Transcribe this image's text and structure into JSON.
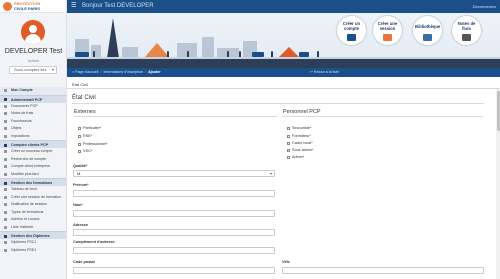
{
  "brand": {
    "line1": "PROTECTION",
    "line2": "CIVILE PARIS"
  },
  "profile": {
    "name": "DEVELOPER Test",
    "role": "Admin",
    "select_value": "Sous comptes liés"
  },
  "topbar": {
    "welcome": "Bonjour Test DEVELOPER",
    "logout": "Déconnexion"
  },
  "nav": {
    "mon_compte": "Mon Compte",
    "sections": [
      {
        "label": "Administratif PCP",
        "items": [
          "Documents PCP",
          "Notes de frais",
          "Fournisseurs",
          "Objets",
          "Imputations"
        ]
      },
      {
        "label": "Comptes clients PCP",
        "items": [
          "Créer un nouveau compte",
          "Recherche de compte",
          "Compte client entreprise",
          "Modifier plus tard"
        ]
      },
      {
        "label": "Gestion des formations",
        "items": [
          "Tableau de bord",
          "Créer une session de formation",
          "Notification de session",
          "Types de formations",
          "Admins et Locaux",
          "Liste d'attente"
        ]
      },
      {
        "label": "Gestion des Diplômes",
        "items": [
          "Diplômes PSC1",
          "Diplômes PSE1"
        ]
      }
    ]
  },
  "tiles": [
    {
      "label": "Créer un compte",
      "icon": "user-plus-icon"
    },
    {
      "label": "Créer une session",
      "icon": "calendar-icon"
    },
    {
      "label": "Bibliothèque",
      "icon": "book-icon"
    },
    {
      "label": "Notes de frais",
      "icon": "receipt-icon"
    }
  ],
  "breadcrumb": {
    "items": [
      "Page d'accueil",
      "Informations d'inscription",
      "Ajouter"
    ],
    "back": "Retour à la liste"
  },
  "tabs": {
    "etat_civil": "État Civil"
  },
  "form": {
    "title": "État Civil",
    "externes": {
      "heading": "Externes",
      "options": [
        "Particulier*",
        "RSE*",
        "Professionnel*",
        "VSC*"
      ]
    },
    "personnel": {
      "heading": "Personnel PCP",
      "options": [
        "Secouriste*",
        "Formateur*",
        "Cadre local*",
        "Sous admin*",
        "Admin*"
      ]
    },
    "fields": {
      "qualite_label": "Qualité*",
      "qualite_value": "M.",
      "prenom_label": "Prénom*",
      "nom_label": "Nom*",
      "adresse_label": "Adresse",
      "complement_label": "Complément d'adresse",
      "code_postal_label": "Code postal",
      "ville_label": "Ville"
    }
  },
  "colors": {
    "primary": "#1b4f8a",
    "accent": "#e8763a",
    "avatar": "#e05a2a"
  }
}
